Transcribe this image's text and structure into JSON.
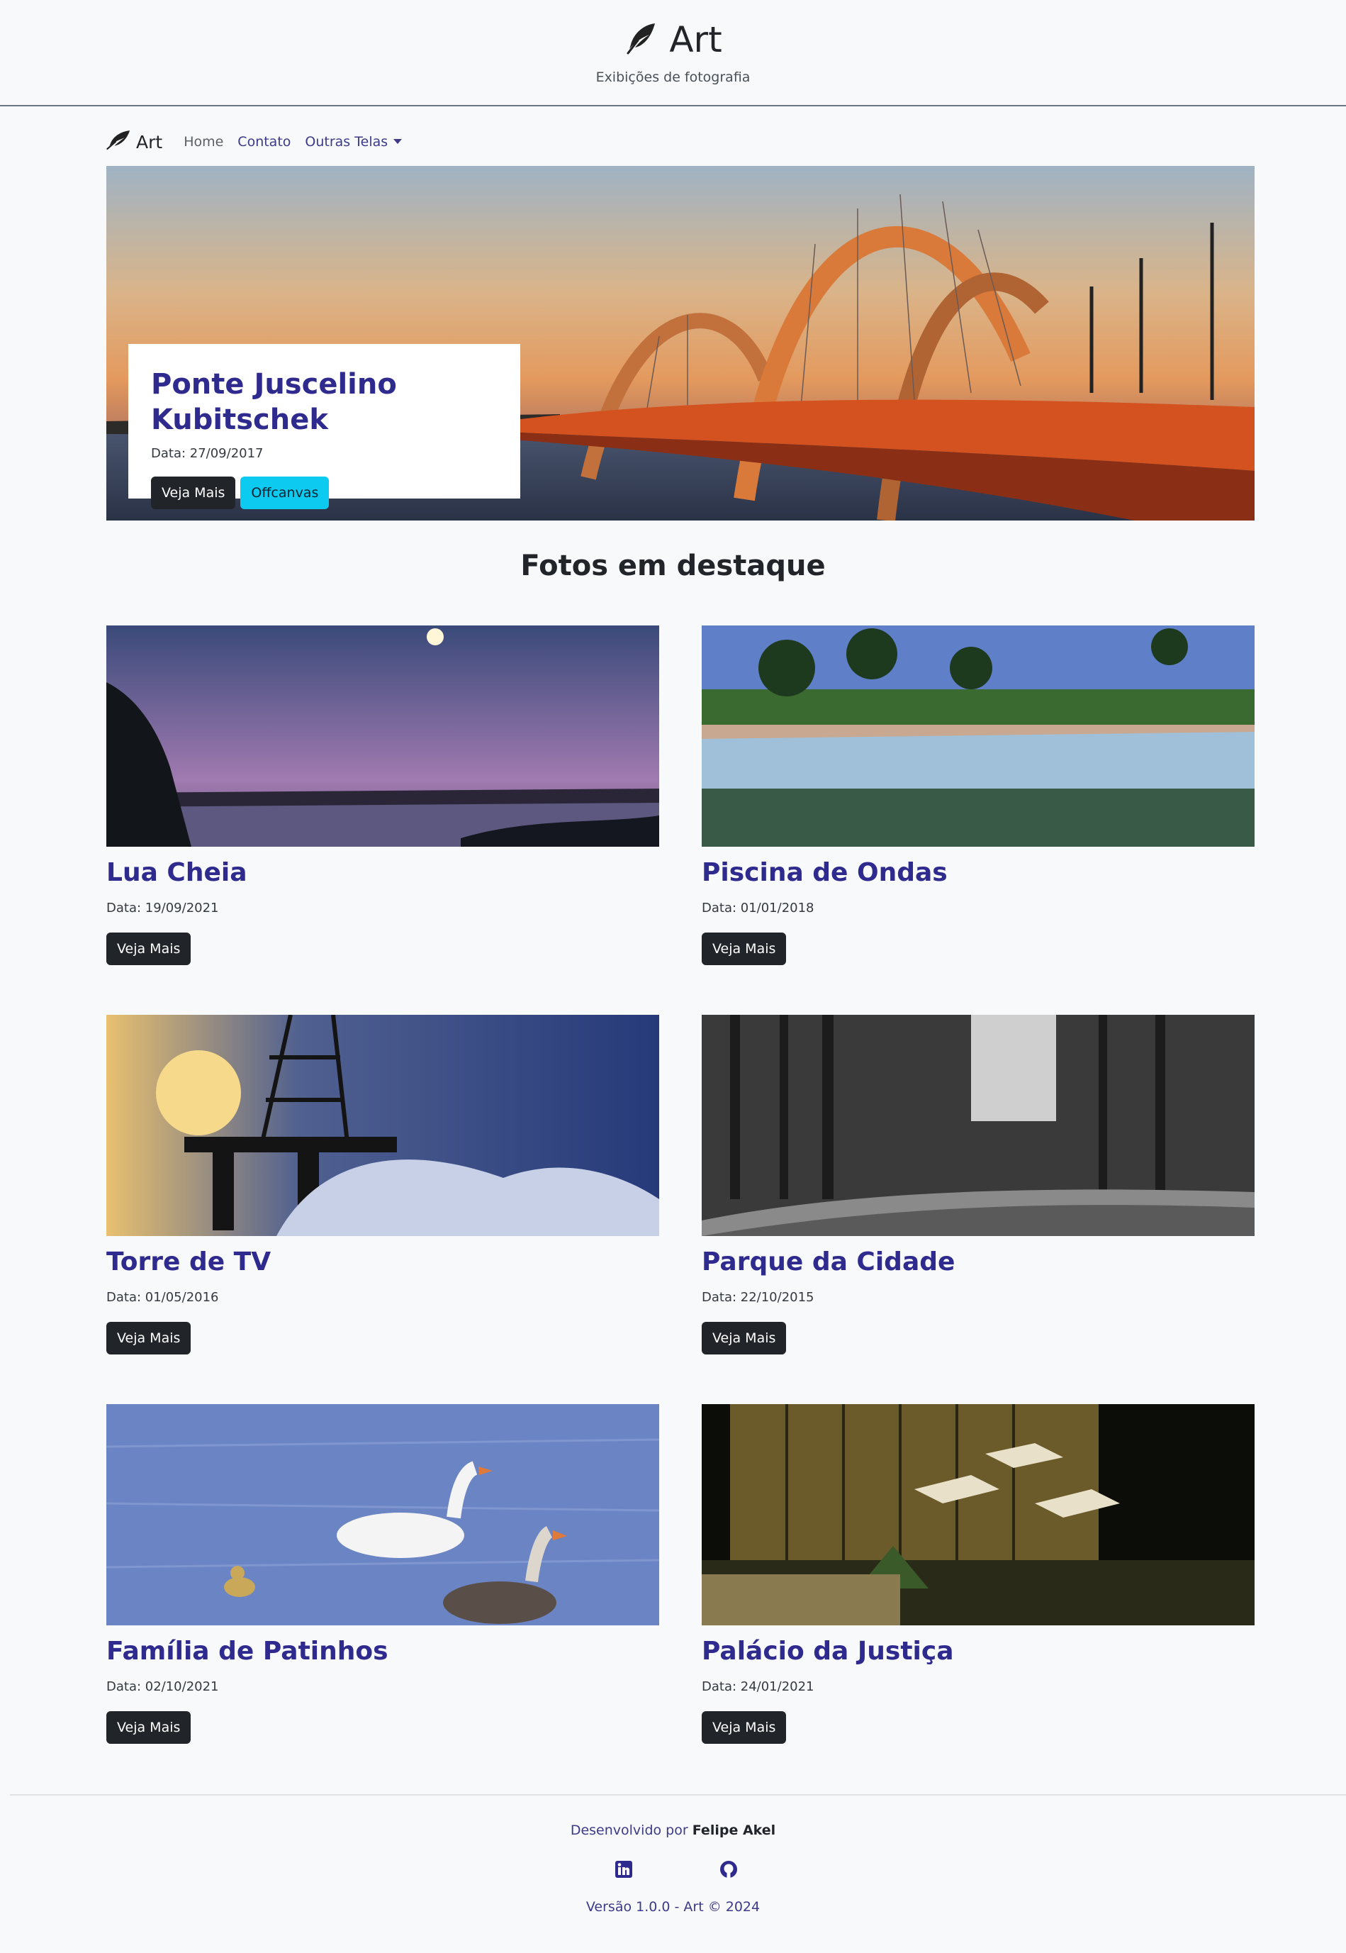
{
  "header": {
    "title": "Art",
    "subtitle": "Exibições de fotografia",
    "logo_icon": "feather-icon"
  },
  "navbar": {
    "brand": "Art",
    "links": [
      "Home",
      "Contato",
      "Outras Telas"
    ]
  },
  "hero": {
    "title": "Ponte Juscelino Kubitschek",
    "date": "Data: 27/09/2017",
    "primary_button": "Veja Mais",
    "secondary_button": "Offcanvas"
  },
  "featured": {
    "title": "Fotos em destaque",
    "cards": [
      {
        "title": "Lua Cheia",
        "date": "Data: 19/09/2021",
        "button": "Veja Mais"
      },
      {
        "title": "Piscina de Ondas",
        "date": "Data: 01/01/2018",
        "button": "Veja Mais"
      },
      {
        "title": "Torre de TV",
        "date": "Data: 01/05/2016",
        "button": "Veja Mais"
      },
      {
        "title": "Parque da Cidade",
        "date": "Data: 22/10/2015",
        "button": "Veja Mais"
      },
      {
        "title": "Família de Patinhos",
        "date": "Data: 02/10/2021",
        "button": "Veja Mais"
      },
      {
        "title": "Palácio da Justiça",
        "date": "Data: 24/01/2021",
        "button": "Veja Mais"
      }
    ]
  },
  "footer": {
    "credit_prefix": "Desenvolvido por",
    "credit_name": "Felipe Akel",
    "icons": [
      "linkedin-icon",
      "github-icon"
    ],
    "version": "Versão 1.0.0 - Art © 2024"
  },
  "colors": {
    "accent": "#2f2a8e",
    "button_dark": "#212529",
    "button_info": "#0dcaf0",
    "background": "#f8f9fa"
  }
}
